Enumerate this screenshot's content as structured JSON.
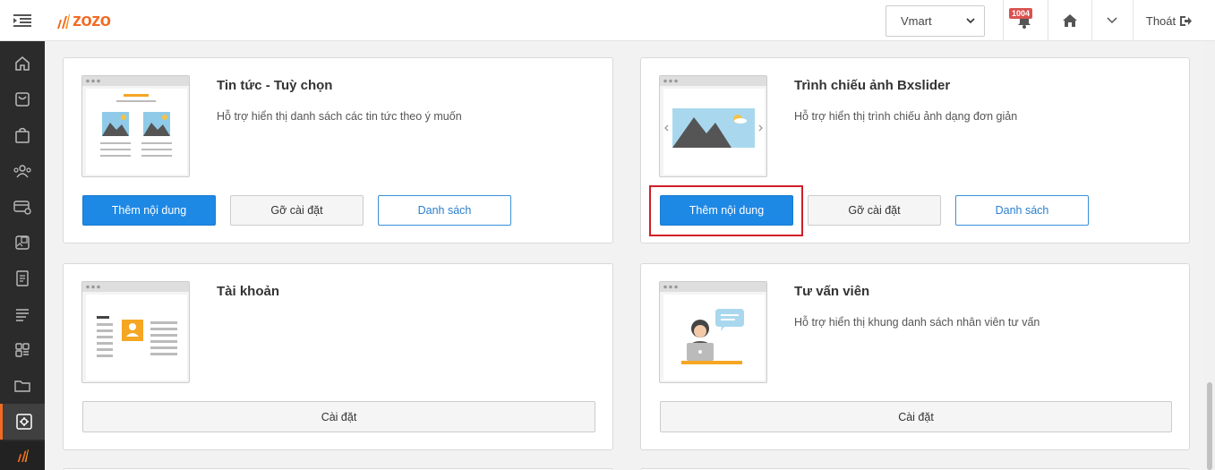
{
  "topbar": {
    "logo_text": "zozo",
    "store_select": {
      "value": "Vmart"
    },
    "notification_count": "1004",
    "logout_label": "Thoát"
  },
  "sidebar": {
    "items": [
      {
        "icon": "home-icon"
      },
      {
        "icon": "inbox-icon"
      },
      {
        "icon": "shopping-bag-icon"
      },
      {
        "icon": "customers-icon"
      },
      {
        "icon": "payment-icon"
      },
      {
        "icon": "media-icon"
      },
      {
        "icon": "document-icon"
      },
      {
        "icon": "list-icon"
      },
      {
        "icon": "apps-icon"
      },
      {
        "icon": "folder-icon"
      },
      {
        "icon": "settings-icon",
        "active": true
      }
    ]
  },
  "modules": [
    {
      "title": "Tin tức - Tuỳ chọn",
      "description": "Hỗ trợ hiển thị danh sách các tin tức theo ý muốn",
      "buttons": {
        "add": "Thêm nội dung",
        "uninstall": "Gỡ cài đặt",
        "list": "Danh sách"
      }
    },
    {
      "title": "Trình chiếu ảnh Bxslider",
      "description": "Hỗ trợ hiển thị trình chiếu ảnh dạng đơn giản",
      "buttons": {
        "add": "Thêm nội dung",
        "uninstall": "Gỡ cài đặt",
        "list": "Danh sách"
      }
    },
    {
      "title": "Tài khoản",
      "description": "",
      "buttons": {
        "install": "Cài đặt"
      }
    },
    {
      "title": "Tư vấn viên",
      "description": "Hỗ trợ hiển thị khung danh sách nhân viên tư vấn",
      "buttons": {
        "install": "Cài đặt"
      }
    }
  ],
  "colors": {
    "accent": "#f26a22",
    "primary": "#1e88e5",
    "highlight": "#d11f2a",
    "sidebar_bg": "#2b2b2b"
  }
}
